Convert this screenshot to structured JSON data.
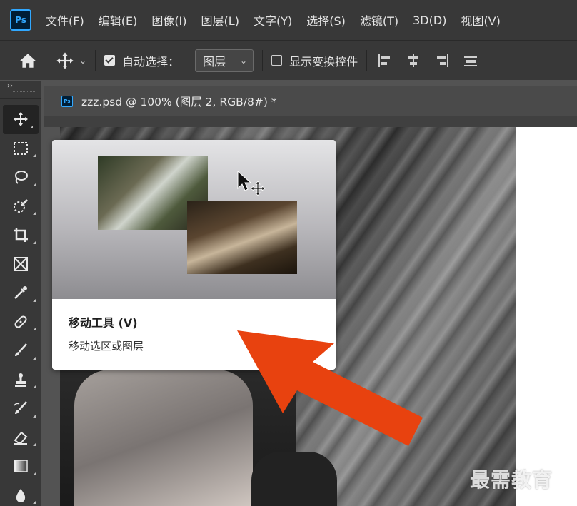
{
  "app": {
    "logo_text": "Ps"
  },
  "menu": {
    "items": [
      "文件(F)",
      "编辑(E)",
      "图像(I)",
      "图层(L)",
      "文字(Y)",
      "选择(S)",
      "滤镜(T)",
      "3D(D)",
      "视图(V)"
    ]
  },
  "options": {
    "auto_select_label": "自动选择：",
    "auto_select_checked": true,
    "layer_dropdown_value": "图层",
    "show_transform_label": "显示变换控件",
    "show_transform_checked": false
  },
  "toolbar": {
    "collapse_glyph": "››",
    "tools": [
      {
        "name": "move-tool",
        "icon": "move-icon"
      },
      {
        "name": "marquee-tool",
        "icon": "rect-marquee-icon"
      },
      {
        "name": "lasso-tool",
        "icon": "lasso-icon"
      },
      {
        "name": "quick-select-tool",
        "icon": "quick-select-icon"
      },
      {
        "name": "crop-tool",
        "icon": "crop-icon"
      },
      {
        "name": "frame-tool",
        "icon": "frame-icon"
      },
      {
        "name": "eyedropper-tool",
        "icon": "eyedropper-icon"
      },
      {
        "name": "healing-tool",
        "icon": "bandage-icon"
      },
      {
        "name": "brush-tool",
        "icon": "brush-icon"
      },
      {
        "name": "stamp-tool",
        "icon": "stamp-icon"
      },
      {
        "name": "history-brush-tool",
        "icon": "history-brush-icon"
      },
      {
        "name": "eraser-tool",
        "icon": "eraser-icon"
      },
      {
        "name": "gradient-tool",
        "icon": "gradient-icon"
      },
      {
        "name": "blur-tool",
        "icon": "drop-icon"
      }
    ]
  },
  "document": {
    "tab_title": "zzz.psd @ 100% (图层 2, RGB/8#) *",
    "icon_text": "Ps"
  },
  "tooltip": {
    "title": "移动工具 (V)",
    "description": "移动选区或图层"
  },
  "colors": {
    "accent_blue": "#31a8ff",
    "annotation_arrow": "#e8420f",
    "panel_dark": "#383838"
  },
  "watermark": "最需教育"
}
